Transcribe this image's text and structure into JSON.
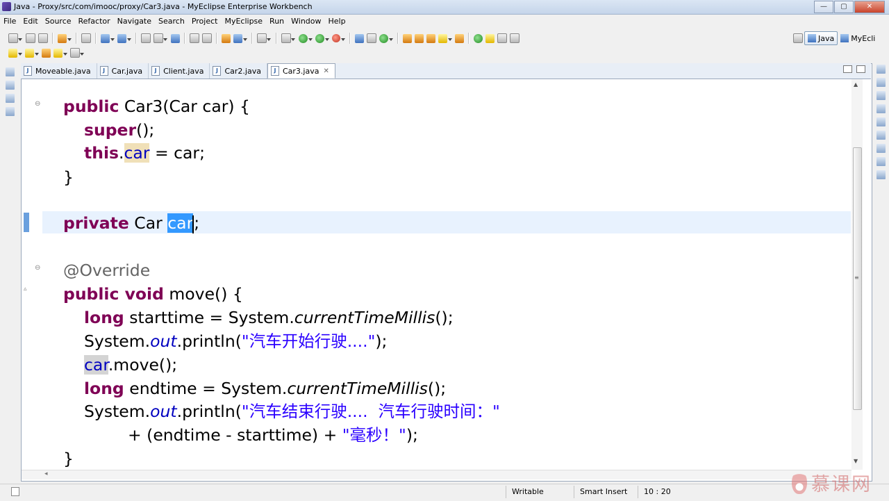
{
  "window": {
    "title": "Java - Proxy/src/com/imooc/proxy/Car3.java - MyEclipse Enterprise Workbench",
    "controls": [
      "—",
      "▢",
      "✕"
    ]
  },
  "menubar": [
    "File",
    "Edit",
    "Source",
    "Refactor",
    "Navigate",
    "Search",
    "Project",
    "MyEclipse",
    "Run",
    "Window",
    "Help"
  ],
  "perspectives": [
    {
      "label": "Java",
      "active": true,
      "icon": "java-perspective-icon"
    },
    {
      "label": "MyEcli",
      "active": false,
      "icon": "myeclipse-perspective-icon"
    }
  ],
  "editor": {
    "tabs": [
      {
        "label": "Moveable.java",
        "active": false
      },
      {
        "label": "Car.java",
        "active": false
      },
      {
        "label": "Client.java",
        "active": false
      },
      {
        "label": "Car2.java",
        "active": false
      },
      {
        "label": "Car3.java",
        "active": true
      }
    ],
    "tab_close_glyph": "✕",
    "fold_glyph": "⊖",
    "code": {
      "l1": {
        "kw": "public",
        "rest": " Car3(Car car) {"
      },
      "l2": {
        "kw": "super",
        "rest": "();"
      },
      "l3": {
        "kw": "this",
        "dot": ".",
        "field": "car",
        "rest": " = car;"
      },
      "l4": {
        "text": "}"
      },
      "l5": {
        "kw": "private",
        "type": " Car ",
        "field": "car",
        "rest": ";"
      },
      "l6": {
        "ann": "@Override"
      },
      "l7": {
        "kw": "public void",
        "rest": " move() {"
      },
      "l8": {
        "kw": "long",
        "pre": " starttime = System.",
        "method": "currentTimeMillis",
        "rest": "();"
      },
      "l9": {
        "pre": "System.",
        "field": "out",
        "mid": ".println(",
        "str": "\"汽车开始行驶....\"",
        "rest": ");"
      },
      "l10": {
        "field": "car",
        "rest": ".move();"
      },
      "l11": {
        "kw": "long",
        "pre": " endtime = System.",
        "method": "currentTimeMillis",
        "rest": "();"
      },
      "l12": {
        "pre": "System.",
        "field": "out",
        "mid": ".println(",
        "str": "\"汽车结束行驶....  汽车行驶时间：\""
      },
      "l13": {
        "pre": "+ (endtime - starttime) + ",
        "str": "\"毫秒！\"",
        "rest": ");"
      },
      "l14": {
        "text": "}"
      }
    }
  },
  "statusbar": {
    "mode": "Writable",
    "insert": "Smart Insert",
    "position": "10 : 20"
  },
  "watermark": {
    "text": "慕课网"
  }
}
